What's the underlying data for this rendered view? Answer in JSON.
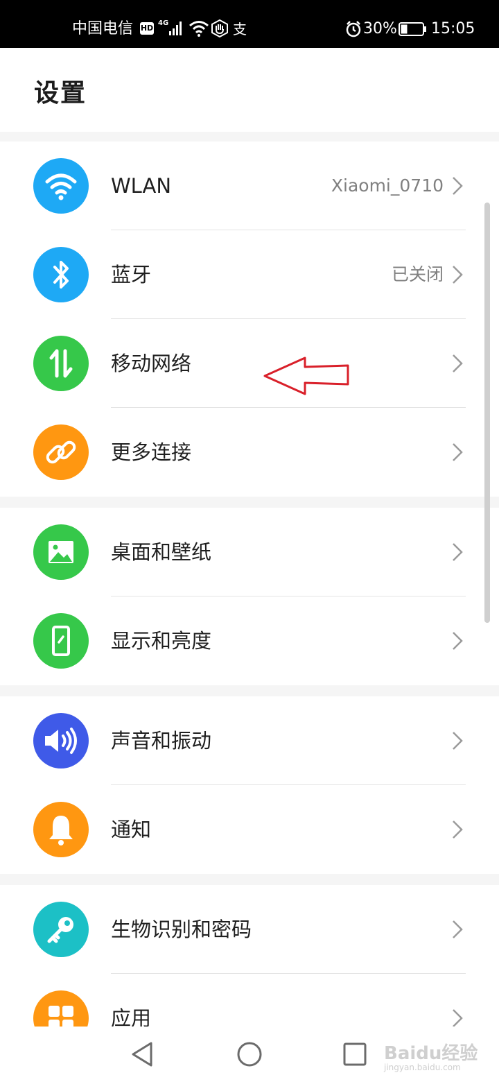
{
  "status_bar": {
    "carrier": "中国电信",
    "hd_badge": "HD",
    "network_type": "4G",
    "extra_icon": "支",
    "battery": "30%",
    "time": "15:05"
  },
  "header": {
    "title": "设置"
  },
  "settings_groups": [
    [
      {
        "label": "WLAN",
        "value": "Xiaomi_0710",
        "icon": "wifi-icon",
        "color": "#1ea9f5"
      },
      {
        "label": "蓝牙",
        "value": "已关闭",
        "icon": "bluetooth-icon",
        "color": "#1ea9f5"
      },
      {
        "label": "移动网络",
        "value": "",
        "icon": "mobile-data-icon",
        "color": "#36c84a"
      },
      {
        "label": "更多连接",
        "value": "",
        "icon": "link-icon",
        "color": "#ff9711"
      }
    ],
    [
      {
        "label": "桌面和壁纸",
        "value": "",
        "icon": "wallpaper-icon",
        "color": "#36c84a"
      },
      {
        "label": "显示和亮度",
        "value": "",
        "icon": "display-icon",
        "color": "#36c84a"
      }
    ],
    [
      {
        "label": "声音和振动",
        "value": "",
        "icon": "sound-icon",
        "color": "#3f5ae8"
      },
      {
        "label": "通知",
        "value": "",
        "icon": "bell-icon",
        "color": "#ff9711"
      }
    ],
    [
      {
        "label": "生物识别和密码",
        "value": "",
        "icon": "key-icon",
        "color": "#1cc0c6"
      },
      {
        "label": "应用",
        "value": "",
        "icon": "apps-icon",
        "color": "#ff9711"
      }
    ]
  ],
  "watermark": {
    "line1": "Baidu经验",
    "line2": "jingyan.baidu.com"
  }
}
